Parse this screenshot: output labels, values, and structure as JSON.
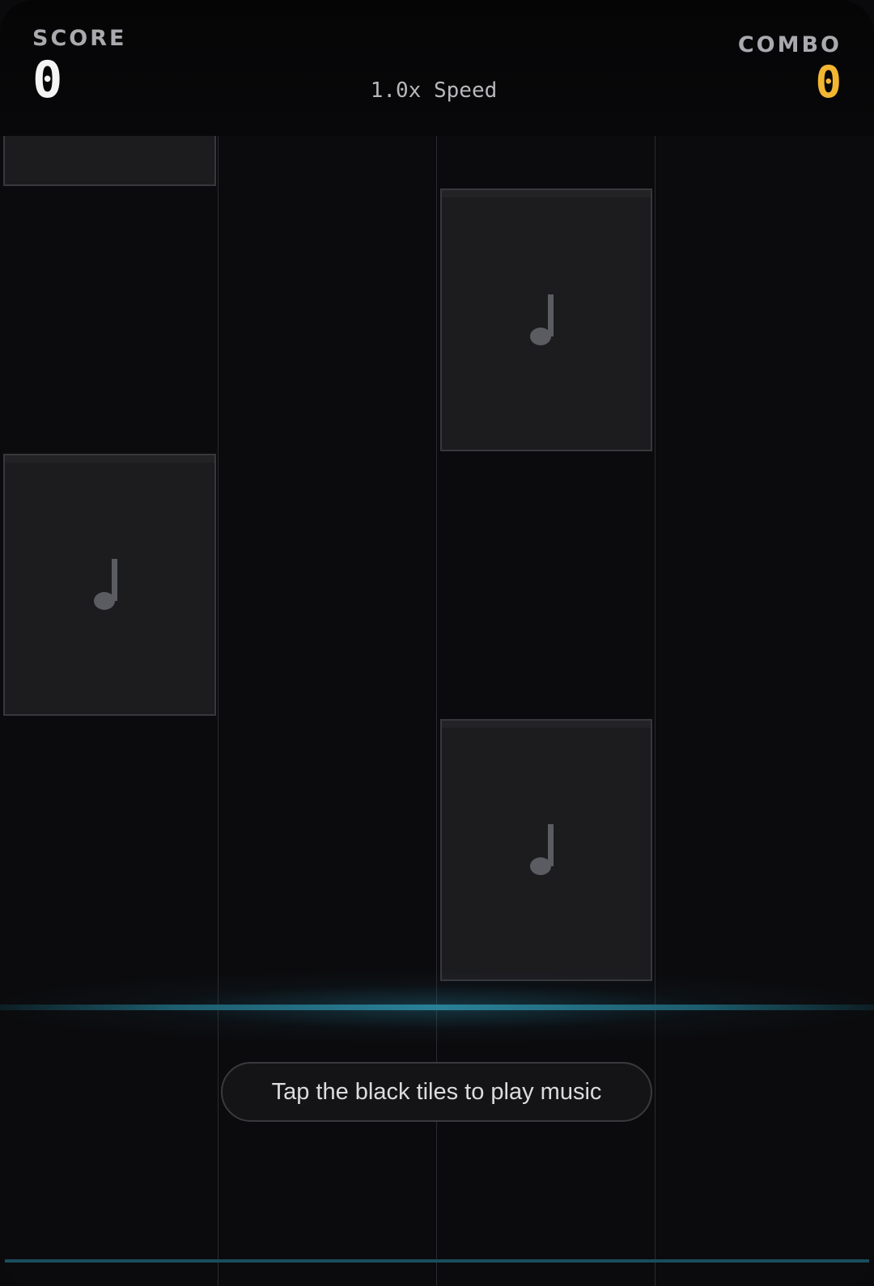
{
  "hud": {
    "score_label": "SCORE",
    "score_value": "0",
    "combo_label": "COMBO",
    "combo_value": "0",
    "speed_text": "1.0x Speed"
  },
  "board": {
    "lanes": 4,
    "tiles": [
      {
        "lane": 1,
        "icon": null,
        "partial": true
      },
      {
        "lane": 3,
        "icon": "music-note-icon"
      },
      {
        "lane": 1,
        "icon": "music-note-icon"
      },
      {
        "lane": 3,
        "icon": "music-note-icon"
      }
    ]
  },
  "hint": {
    "text": "Tap the black tiles to play music"
  },
  "colors": {
    "background": "#0b0b0d",
    "tile": "#1c1c1f",
    "combo": "#f2b632",
    "hit_line": "#2a8198"
  }
}
